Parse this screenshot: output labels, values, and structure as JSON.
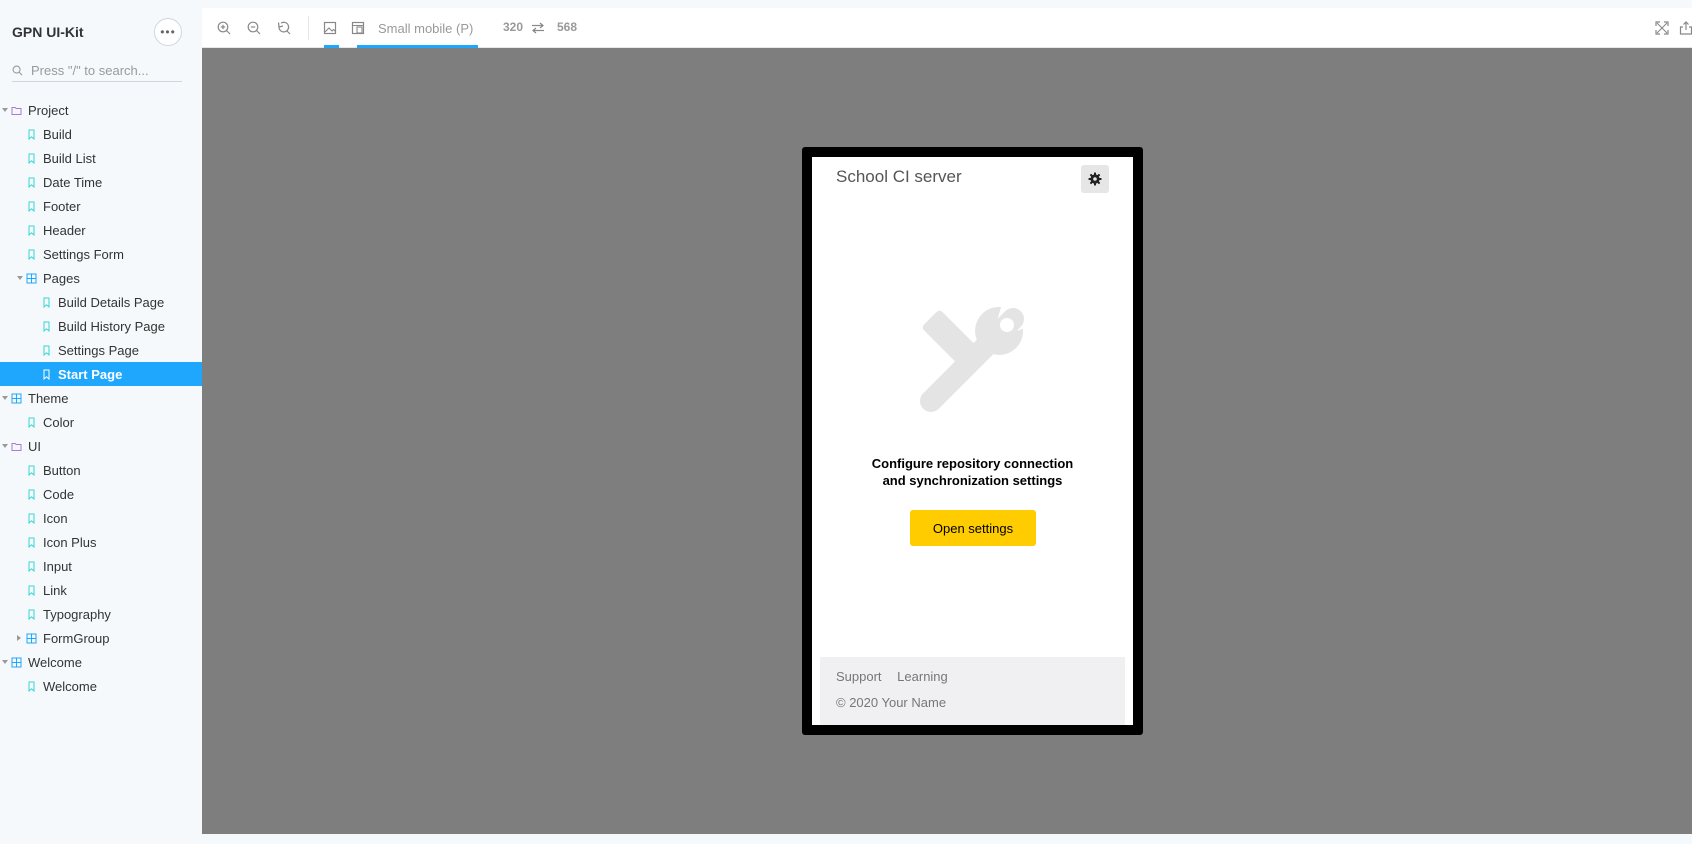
{
  "sidebar": {
    "title": "GPN UI-Kit",
    "menu_label": "•••",
    "search": {
      "placeholder": "Press \"/\" to search..."
    },
    "tree": [
      {
        "label": "Project",
        "icon": "folder-icon",
        "level": 0,
        "expanded": true
      },
      {
        "label": "Build",
        "icon": "bookmark-icon",
        "level": 1
      },
      {
        "label": "Build List",
        "icon": "bookmark-icon",
        "level": 1
      },
      {
        "label": "Date Time",
        "icon": "bookmark-icon",
        "level": 1
      },
      {
        "label": "Footer",
        "icon": "bookmark-icon",
        "level": 1
      },
      {
        "label": "Header",
        "icon": "bookmark-icon",
        "level": 1
      },
      {
        "label": "Settings Form",
        "icon": "bookmark-icon",
        "level": 1
      },
      {
        "label": "Pages",
        "icon": "component-icon",
        "level": 1,
        "expanded": true
      },
      {
        "label": "Build Details Page",
        "icon": "bookmark-icon",
        "level": 2
      },
      {
        "label": "Build History Page",
        "icon": "bookmark-icon",
        "level": 2
      },
      {
        "label": "Settings Page",
        "icon": "bookmark-icon",
        "level": 2
      },
      {
        "label": "Start Page",
        "icon": "bookmark-icon",
        "level": 2,
        "selected": true
      },
      {
        "label": "Theme",
        "icon": "component-icon",
        "level": 0,
        "expanded": true
      },
      {
        "label": "Color",
        "icon": "bookmark-icon",
        "level": 1
      },
      {
        "label": "UI",
        "icon": "folder-icon",
        "level": 0,
        "expanded": true
      },
      {
        "label": "Button",
        "icon": "bookmark-icon",
        "level": 1
      },
      {
        "label": "Code",
        "icon": "bookmark-icon",
        "level": 1
      },
      {
        "label": "Icon",
        "icon": "bookmark-icon",
        "level": 1
      },
      {
        "label": "Icon Plus",
        "icon": "bookmark-icon",
        "level": 1
      },
      {
        "label": "Input",
        "icon": "bookmark-icon",
        "level": 1
      },
      {
        "label": "Link",
        "icon": "bookmark-icon",
        "level": 1
      },
      {
        "label": "Typography",
        "icon": "bookmark-icon",
        "level": 1
      },
      {
        "label": "FormGroup",
        "icon": "component-icon",
        "level": 1,
        "expanded": false
      },
      {
        "label": "Welcome",
        "icon": "component-icon",
        "level": 0,
        "expanded": true
      },
      {
        "label": "Welcome",
        "icon": "bookmark-icon",
        "level": 1
      }
    ]
  },
  "toolbar": {
    "viewport_label": "Small mobile (P)",
    "width": "320",
    "height": "568",
    "buttons": [
      "zoom-in-icon",
      "zoom-out-icon",
      "zoom-reset-icon",
      "background-icon",
      "viewport-icon",
      "swap-icon",
      "fullscreen-icon",
      "share-icon"
    ]
  },
  "preview": {
    "app_title": "School CI server",
    "message_line1": "Configure repository connection",
    "message_line2": "and synchronization settings",
    "cta_label": "Open settings",
    "footer_links": [
      "Support",
      "Learning"
    ],
    "copyright": "© 2020 Your Name"
  },
  "colors": {
    "accent": "#1ea7fd",
    "cta": "#ffcc00",
    "canvas": "#7e7e7e"
  }
}
